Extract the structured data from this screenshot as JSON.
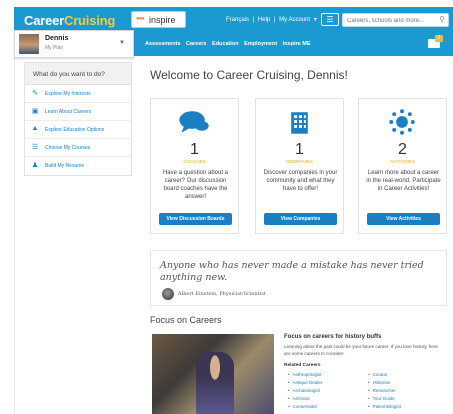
{
  "header": {
    "logo_part1": "Career",
    "logo_part2": "Cruising",
    "inspire_label": "inspire",
    "links": [
      "Français",
      "|",
      "Help",
      "|",
      "My Account",
      "▾"
    ],
    "search_placeholder": "Careers, schools and more...",
    "brand_color": "#1b9ad1",
    "accent_color": "#f7c842"
  },
  "user": {
    "name": "Dennis",
    "plan": "My Plan"
  },
  "nav": {
    "items": [
      "Assessments",
      "Careers",
      "Education",
      "Employment",
      "Inspire ME"
    ],
    "message_count": "2"
  },
  "sidebar": {
    "title": "What do you want to do?",
    "items": [
      {
        "label": "Explore My Interests",
        "icon": "pencil-icon"
      },
      {
        "label": "Learn About Careers",
        "icon": "briefcase-icon"
      },
      {
        "label": "Explore Education Options",
        "icon": "graduation-cap-icon"
      },
      {
        "label": "Choose My Courses",
        "icon": "list-icon"
      },
      {
        "label": "Build My Resume",
        "icon": "people-icon"
      }
    ]
  },
  "main": {
    "welcome": "Welcome to Career Cruising, Dennis!",
    "cards": [
      {
        "count": "1",
        "label": "COACHES",
        "desc": "Have a question about a career? Our discussion board coaches have the answer!",
        "button": "View Discussion Boards",
        "icon": "chat-icon"
      },
      {
        "count": "1",
        "label": "COMPANIES",
        "desc": "Discover companies in your community and what they have to offer!",
        "button": "View Companies",
        "icon": "building-icon"
      },
      {
        "count": "2",
        "label": "ACTIVITIES",
        "desc": "Learn more about a career in the real-world. Participate in Career Activities!",
        "button": "View Activities",
        "icon": "sun-icon"
      }
    ],
    "quote": "Anyone who has never made a mistake has never tried anything new.",
    "quote_author": "Albert Einstein, Physicist/Scientist",
    "focus_title": "Focus on Careers",
    "focus_sub": "Focus on careers for history buffs",
    "focus_desc": "Learning about the past could be your future career. If you love history, here are some careers to consider.",
    "related_heading": "Related Careers",
    "related_left": [
      "Anthropologist",
      "Antique Dealer",
      "Archaeologist",
      "Archivist",
      "Conservator"
    ],
    "related_right": [
      "Curator",
      "Historian",
      "Researcher",
      "Tour Guide",
      "Paleontologist"
    ]
  }
}
